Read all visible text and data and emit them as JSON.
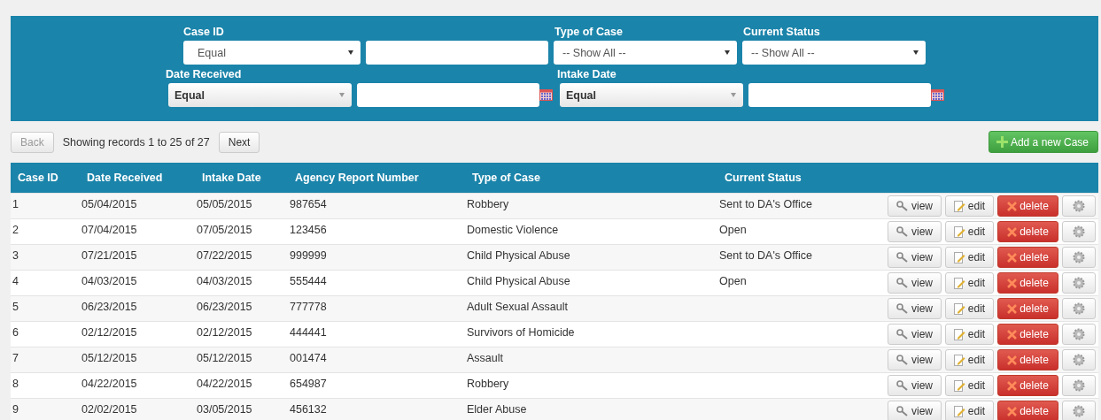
{
  "filter_rows": [
    [
      {
        "kind": "text_match",
        "label": "Case ID",
        "operator": "Equal"
      },
      {
        "kind": "dropdown",
        "label": "Type of Case",
        "value": "-- Show All --"
      },
      {
        "kind": "dropdown",
        "label": "Current Status",
        "value": "-- Show All --"
      }
    ],
    [
      {
        "kind": "date_match",
        "label": "Date Received",
        "operator": "Equal"
      },
      {
        "kind": "date_match",
        "label": "Intake Date",
        "operator": "Equal"
      }
    ]
  ],
  "pager": {
    "back": {
      "label": "Back",
      "disabled": true
    },
    "summary": "Showing records 1 to 25 of 27",
    "next": {
      "label": "Next",
      "disabled": false
    }
  },
  "add_button": "Add a new Case",
  "table": {
    "columns": [
      "Case ID",
      "Date Received",
      "Intake Date",
      "Agency Report Number",
      "Type of Case",
      "Current Status"
    ],
    "rows": [
      {
        "cells": [
          "1",
          "05/04/2015",
          "05/05/2015",
          "987654",
          "Robbery",
          "Sent to DA's Office"
        ],
        "actions": [
          "view",
          "edit",
          "delete"
        ]
      },
      {
        "cells": [
          "2",
          "07/04/2015",
          "07/05/2015",
          "123456",
          "Domestic Violence",
          "Open"
        ],
        "actions": [
          "view",
          "edit",
          "delete"
        ]
      },
      {
        "cells": [
          "3",
          "07/21/2015",
          "07/22/2015",
          "999999",
          "Child Physical Abuse",
          "Sent to DA's Office"
        ],
        "actions": [
          "view",
          "edit",
          "delete"
        ]
      },
      {
        "cells": [
          "4",
          "04/03/2015",
          "04/03/2015",
          "555444",
          "Child Physical Abuse",
          "Open"
        ],
        "actions": [
          "view",
          "edit",
          "delete"
        ]
      },
      {
        "cells": [
          "5",
          "06/23/2015",
          "06/23/2015",
          "777778",
          "Adult Sexual Assault",
          ""
        ],
        "actions": [
          "view",
          "edit",
          "delete"
        ]
      },
      {
        "cells": [
          "6",
          "02/12/2015",
          "02/12/2015",
          "444441",
          "Survivors of Homicide",
          ""
        ],
        "actions": [
          "view",
          "edit",
          "delete"
        ]
      },
      {
        "cells": [
          "7",
          "05/12/2015",
          "05/12/2015",
          "001474",
          "Assault",
          ""
        ],
        "actions": [
          "view",
          "edit",
          "delete"
        ]
      },
      {
        "cells": [
          "8",
          "04/22/2015",
          "04/22/2015",
          "654987",
          "Robbery",
          ""
        ],
        "actions": [
          "view",
          "edit",
          "delete"
        ]
      },
      {
        "cells": [
          "9",
          "02/02/2015",
          "03/05/2015",
          "456132",
          "Elder Abuse",
          ""
        ],
        "actions": [
          "view",
          "edit",
          "delete"
        ]
      }
    ]
  }
}
